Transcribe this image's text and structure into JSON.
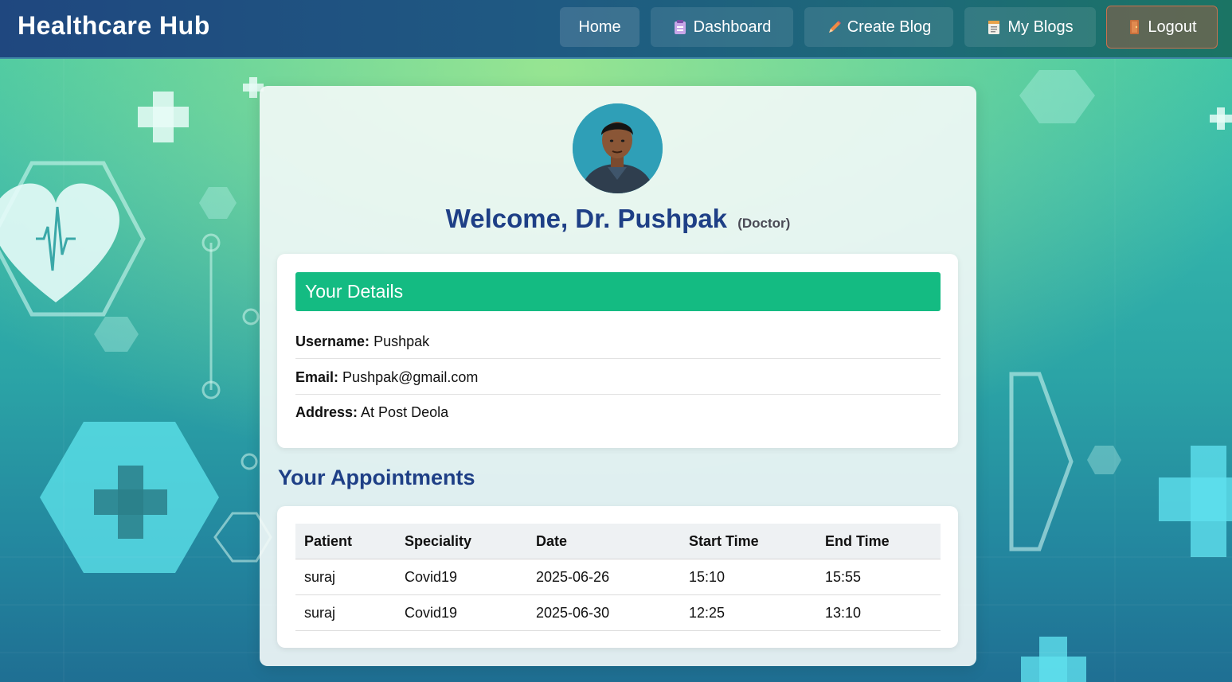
{
  "navbar": {
    "brand": "Healthcare Hub",
    "items": [
      {
        "label": "Home",
        "icon": ""
      },
      {
        "label": "Dashboard",
        "icon": "clipboard-icon"
      },
      {
        "label": "Create Blog",
        "icon": "pencil-icon"
      },
      {
        "label": "My Blogs",
        "icon": "notepad-icon"
      },
      {
        "label": "Logout",
        "icon": "door-icon"
      }
    ]
  },
  "profile": {
    "welcome": "Welcome, Dr. Pushpak",
    "role": "(Doctor)"
  },
  "details": {
    "heading": "Your Details",
    "fields": [
      {
        "label": "Username:",
        "value": "Pushpak"
      },
      {
        "label": "Email:",
        "value": "Pushpak@gmail.com"
      },
      {
        "label": "Address:",
        "value": "At Post Deola"
      }
    ]
  },
  "appointments": {
    "heading": "Your Appointments",
    "columns": [
      "Patient",
      "Speciality",
      "Date",
      "Start Time",
      "End Time"
    ],
    "rows": [
      [
        "suraj",
        "Covid19",
        "2025-06-26",
        "15:10",
        "15:55"
      ],
      [
        "suraj",
        "Covid19",
        "2025-06-30",
        "12:25",
        "13:10"
      ]
    ]
  },
  "colors": {
    "brand_blue": "#1e3f86",
    "details_header": "#14bb82",
    "logout_border": "#c9714f"
  }
}
